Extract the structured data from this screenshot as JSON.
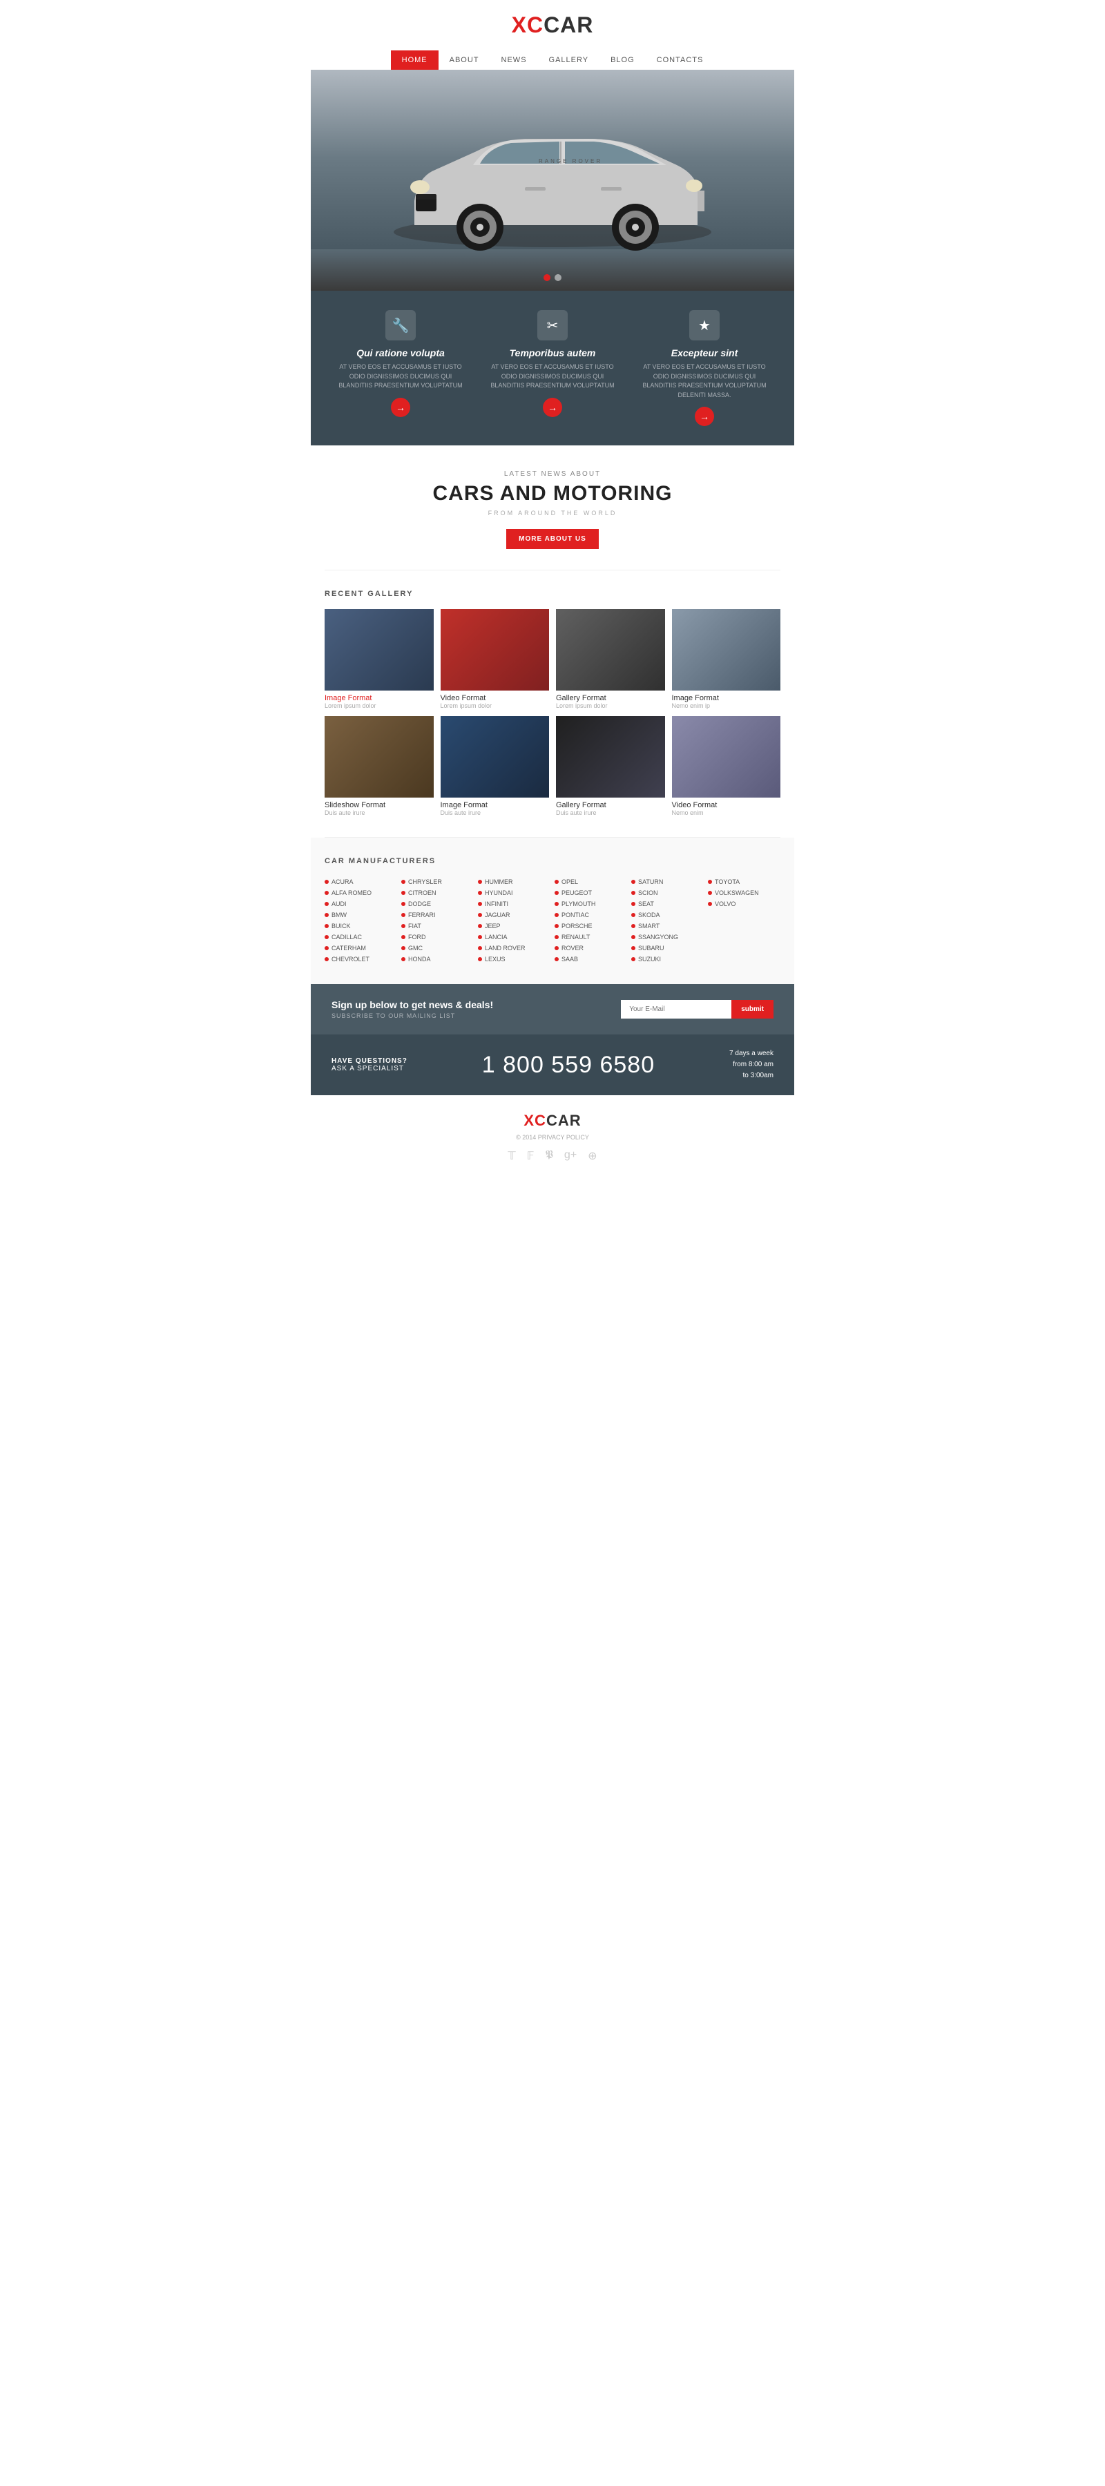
{
  "header": {
    "logo_xc": "XC",
    "logo_car": "CAR"
  },
  "nav": {
    "items": [
      {
        "label": "HOME",
        "active": true
      },
      {
        "label": "ABOUT",
        "active": false
      },
      {
        "label": "NEWS",
        "active": false
      },
      {
        "label": "GALLERY",
        "active": false
      },
      {
        "label": "BLOG",
        "active": false
      },
      {
        "label": "CONTACTS",
        "active": false
      }
    ]
  },
  "hero": {
    "dot1": "active",
    "dot2": ""
  },
  "features": [
    {
      "icon": "🔧",
      "title": "Qui ratione volupta",
      "body": "AT VERO EOS ET ACCUSAMUS ET IUSTO ODIO DIGNISSIMOS DUCIMUS QUI BLANDITIIS PRAESENTIUM VOLUPTATUM",
      "btn": "→"
    },
    {
      "icon": "✂",
      "title": "Temporibus autem",
      "body": "AT VERO EOS ET ACCUSAMUS ET IUSTO ODIO DIGNISSIMOS DUCIMUS QUI BLANDITIIS PRAESENTIUM VOLUPTATUM",
      "btn": "→"
    },
    {
      "icon": "★",
      "title": "Excepteur sint",
      "body": "AT VERO EOS ET ACCUSAMUS ET IUSTO ODIO DIGNISSIMOS DUCIMUS QUI BLANDITIIS PRAESENTIUM VOLUPTATUM DELENITI MASSA.",
      "btn": "→"
    }
  ],
  "news_section": {
    "subtitle": "LATEST NEWS ABOUT",
    "title": "CARS AND MOTORING",
    "tagline": "FROM AROUND THE WORLD",
    "button": "MORE ABOUT US"
  },
  "gallery": {
    "section_title": "RECENT GALLERY",
    "items_row1": [
      {
        "format": "Image Format",
        "format_class": "red",
        "sub": "Lorem ipsum dolor"
      },
      {
        "format": "Video Format",
        "format_class": "",
        "sub": "Lorem ipsum dolor"
      },
      {
        "format": "Gallery Format",
        "format_class": "",
        "sub": "Lorem ipsum dolor"
      },
      {
        "format": "Image Format",
        "format_class": "",
        "sub": "Nemo enim ip"
      }
    ],
    "items_row2": [
      {
        "format": "Slideshow Format",
        "format_class": "",
        "sub": "Duis aute irure"
      },
      {
        "format": "Image Format",
        "format_class": "",
        "sub": "Duis aute irure"
      },
      {
        "format": "Gallery Format",
        "format_class": "",
        "sub": "Duis aute irure"
      },
      {
        "format": "Video Format",
        "format_class": "",
        "sub": "Nemo enim"
      }
    ]
  },
  "manufacturers": {
    "section_title": "CAR MANUFACTURERS",
    "columns": [
      [
        "ACURA",
        "ALFA ROMEO",
        "AUDI",
        "BMW",
        "BUICK",
        "CADILLAC",
        "CATERHAM",
        "CHEVROLET"
      ],
      [
        "CHRYSLER",
        "CITROEN",
        "DODGE",
        "FERRARI",
        "FIAT",
        "FORD",
        "GMC",
        "HONDA"
      ],
      [
        "HUMMER",
        "HYUNDAI",
        "INFINITI",
        "JAGUAR",
        "JEEP",
        "LANCIA",
        "LAND ROVER",
        "LEXUS"
      ],
      [
        "OPEL",
        "PEUGEOT",
        "PLYMOUTH",
        "PONTIAC",
        "PORSCHE",
        "RENAULT",
        "ROVER",
        "SAAB"
      ],
      [
        "SATURN",
        "SCION",
        "SEAT",
        "SKODA",
        "SMART",
        "SSANGYONG",
        "SUBARU",
        "SUZUKI"
      ],
      [
        "TOYOTA",
        "VOLKSWAGEN",
        "VOLVO"
      ]
    ]
  },
  "signup": {
    "title": "Sign up below to get news & deals!",
    "subtitle": "SUBSCRIBE TO OUR MAILING LIST",
    "placeholder": "Your E-Mail",
    "button": "submit"
  },
  "contact": {
    "have_questions": "HAVE QUESTIONS?",
    "ask": "ASK A SPECIALIST",
    "phone": "1 800 559 6580",
    "hours_line1": "7 days a week",
    "hours_line2": "from 8:00 am",
    "hours_line3": "to 3:00am"
  },
  "footer": {
    "logo_xc": "XC",
    "logo_car": "CAR",
    "copyright": "© 2014  PRIVACY POLICY",
    "social_icons": [
      "𝕏",
      "f",
      "𝐏",
      "g+",
      "⌥"
    ]
  }
}
